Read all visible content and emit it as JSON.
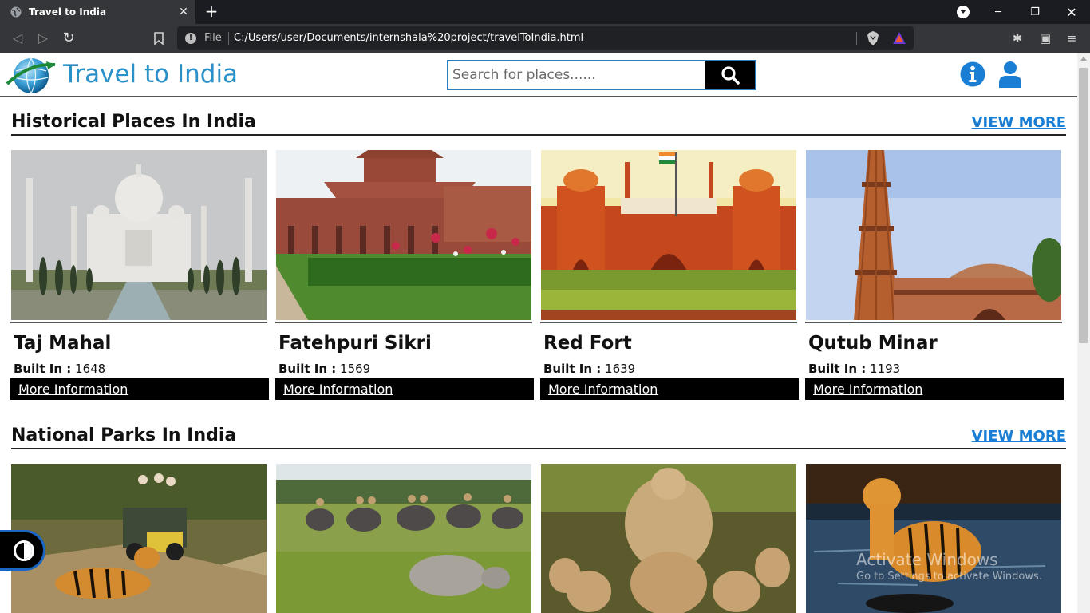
{
  "browser": {
    "tab_title": "Travel to India",
    "omnibox_scheme": "File",
    "url": "C:/Users/user/Documents/internshala%20project/travelToIndia.html"
  },
  "header": {
    "brand": "Travel to India",
    "search_placeholder": "Search for places......"
  },
  "sections": [
    {
      "title": "Historical Places In India",
      "view_more": "VIEW MORE",
      "cards": [
        {
          "name": "Taj Mahal",
          "built_label": "Built In :",
          "built_value": " 1648",
          "more": "More Information"
        },
        {
          "name": "Fatehpuri Sikri",
          "built_label": "Built In :",
          "built_value": " 1569",
          "more": "More Information"
        },
        {
          "name": "Red Fort",
          "built_label": "Built In :",
          "built_value": " 1639",
          "more": "More Information"
        },
        {
          "name": "Qutub Minar",
          "built_label": "Built In :",
          "built_value": " 1193",
          "more": "More Information"
        }
      ]
    },
    {
      "title": "National Parks In India",
      "view_more": "VIEW MORE"
    }
  ],
  "watermark": {
    "line1": "Activate Windows",
    "line2": "Go to Settings to activate Windows."
  },
  "colors": {
    "brand_blue": "#2a90c8",
    "link_blue": "#1a7fd4",
    "chrome_dark": "#35363a",
    "tabbar": "#1b1c22"
  }
}
